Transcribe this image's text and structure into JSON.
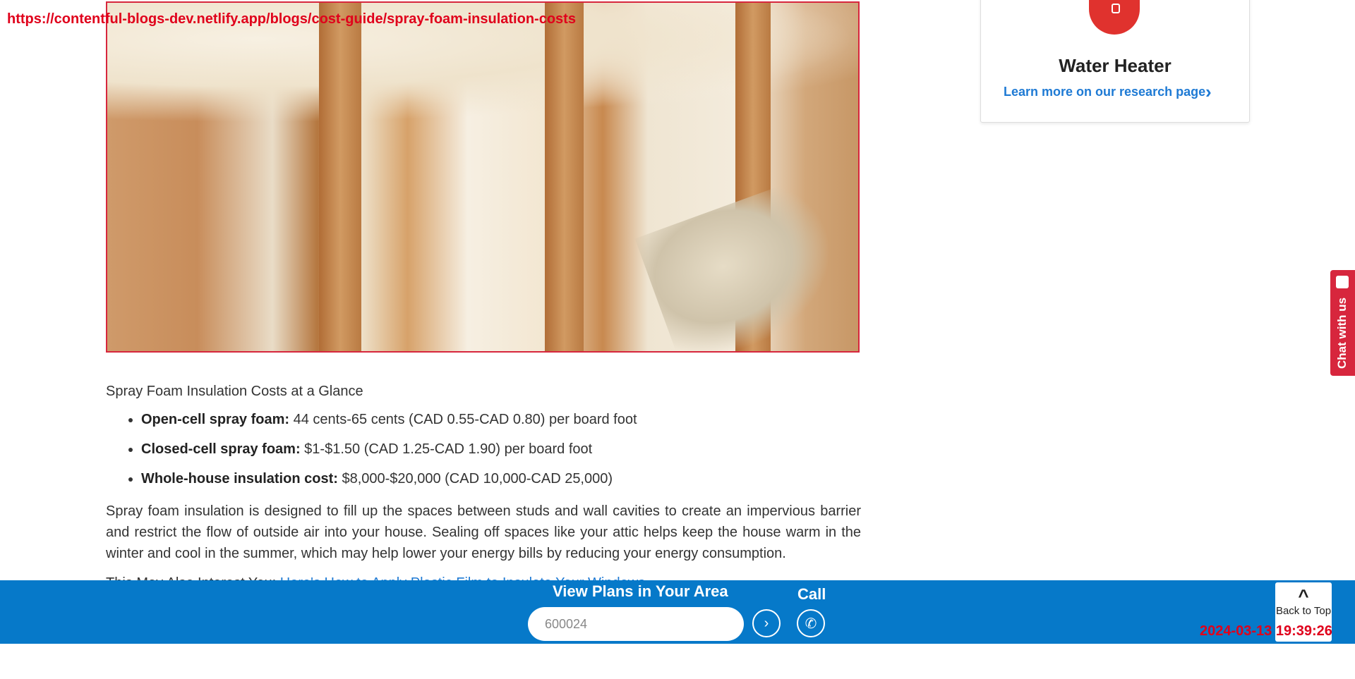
{
  "overlay": {
    "url": "https://contentful-blogs-dev.netlify.app/blogs/cost-guide/spray-foam-insulation-costs",
    "timestamp": "2024-03-13 19:39:26"
  },
  "article": {
    "glance_heading": "Spray Foam Insulation Costs at a Glance",
    "facts": [
      {
        "label": "Open-cell spray foam:",
        "value": " 44 cents-65 cents (CAD 0.55-CAD 0.80) per board foot"
      },
      {
        "label": "Closed-cell spray foam:",
        "value": " $1-$1.50 (CAD 1.25-CAD 1.90) per board foot"
      },
      {
        "label": "Whole-house insulation cost:",
        "value": " $8,000-$20,000 (CAD 10,000-CAD 25,000)"
      }
    ],
    "paragraph": "Spray foam insulation is designed to fill up the spaces between studs and wall cavities to create an impervious barrier and restrict the flow of outside air into your house. Sealing off spaces like your attic helps keep the house warm in the winter and cool in the summer, which may help lower your energy bills by reducing your energy consumption.",
    "also_prefix": "This May Also Interest You: ",
    "also_link": "Here's How to Apply Plastic Film to Insulate Your Windows"
  },
  "sidebar": {
    "card_title": "Water Heater",
    "card_link": "Learn more on our research page"
  },
  "chat": {
    "label": "Chat with us"
  },
  "bottom_bar": {
    "view_plans": "View Plans in Your Area",
    "zip_value": "600024",
    "call_label": "Call"
  },
  "back_to_top": {
    "label": "Back to Top"
  },
  "colors": {
    "brand_blue": "#0679c9",
    "accent_red": "#d7263d",
    "link_blue": "#1e7ad4"
  }
}
